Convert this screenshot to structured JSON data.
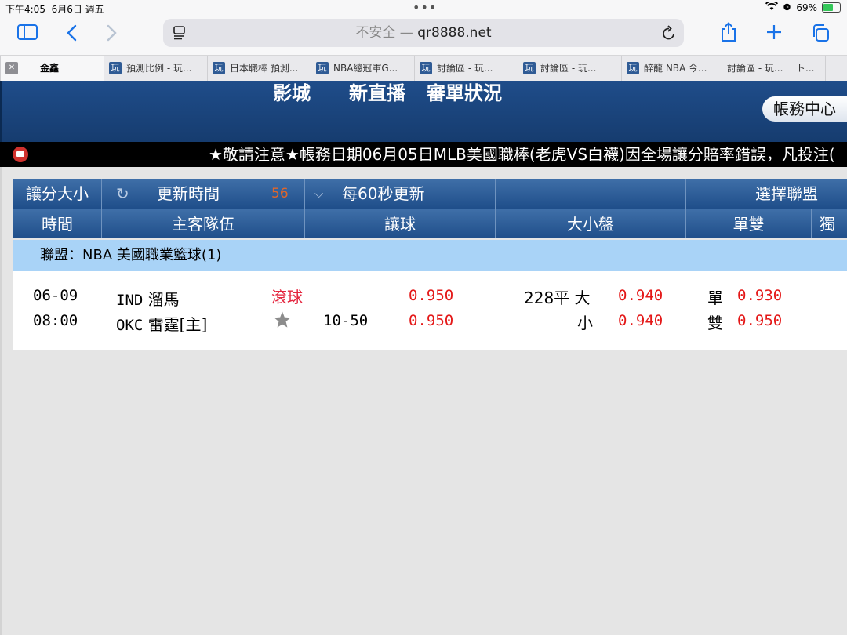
{
  "status_bar": {
    "time": "下午4:05",
    "date": "6月6日 週五",
    "battery": "69%",
    "battery_level": 0.69
  },
  "browser": {
    "address_prefix": "不安全 —",
    "address": "qr8888.net",
    "tabs": [
      {
        "label": "金鑫"
      },
      {
        "label": "預測比例 - 玩..."
      },
      {
        "label": "日本職棒 預測..."
      },
      {
        "label": "NBA總冠軍G..."
      },
      {
        "label": "討論區 - 玩..."
      },
      {
        "label": "討論區 - 玩..."
      },
      {
        "label": "醉龍 NBA 今..."
      },
      {
        "label": "討論區 - 玩..."
      },
      {
        "label": "ト..."
      }
    ],
    "favicon_glyph": "玩",
    "close_glyph": "✕"
  },
  "site_nav": {
    "items": [
      "影城",
      "新直播",
      "審單狀況"
    ],
    "account_center": "帳務中心"
  },
  "ticker": "★敬請注意★帳務日期06月05日MLB美國職棒(老虎VS白襪)因全場讓分賠率錯誤，凡投注(",
  "table": {
    "toolbar": {
      "mode": "讓分大小",
      "refresh_label": "更新時間",
      "countdown": "56",
      "interval": "每60秒更新",
      "select_league": "選擇聯盟"
    },
    "columns": [
      "時間",
      "主客隊伍",
      "讓球",
      "大小盤",
      "單雙",
      "獨"
    ],
    "league": "聯盟：NBA 美國職業籃球(1)",
    "match": {
      "date": "06-09",
      "time": "08:00",
      "away_code": "IND",
      "away_name": "溜馬",
      "home_code": "OKC",
      "home_name": "雷霆[主]",
      "live_label": "滾球",
      "handicap": "10-50",
      "handicap_odds_away": "0.950",
      "handicap_odds_home": "0.950",
      "total_line": "228平",
      "over_label": "大",
      "over_odds": "0.940",
      "under_label": "小",
      "under_odds": "0.940",
      "odd_label": "單",
      "odd_odds": "0.930",
      "even_label": "雙",
      "even_odds": "0.950"
    }
  },
  "colors": {
    "header_blue": "#1f4e8a",
    "league_bg": "#a9d3f7",
    "odds_red": "#e41818"
  }
}
